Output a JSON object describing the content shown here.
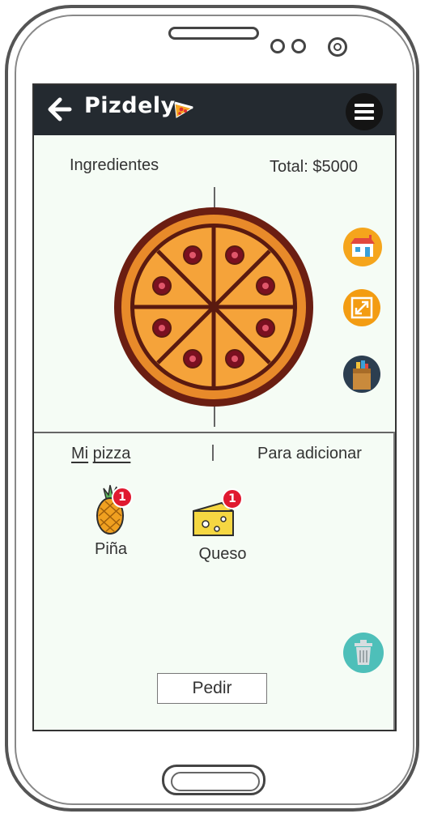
{
  "header": {
    "app_title": "Pizdely",
    "back_icon": "arrow-left-icon",
    "menu_icon": "hamburger-menu-icon",
    "bar_color": "#242a30"
  },
  "builder": {
    "ingredients_label": "Ingredientes",
    "total_label": "Total: $5000"
  },
  "side_actions": [
    {
      "icon": "store-icon",
      "color": "#f5a51c"
    },
    {
      "icon": "expand-icon",
      "color": "#f39c12"
    },
    {
      "icon": "grocery-bag-icon",
      "color": "#2c3e50"
    }
  ],
  "tabs": {
    "my_pizza_prefix": "Mi",
    "my_pizza_word": "pizza",
    "to_add": "Para adicionar"
  },
  "ingredients": [
    {
      "name": "Piña",
      "icon": "pineapple-icon",
      "count": "1"
    },
    {
      "name": "Queso",
      "icon": "cheese-icon",
      "count": "1"
    }
  ],
  "trash_icon": "trash-icon",
  "order_button": "Pedir"
}
